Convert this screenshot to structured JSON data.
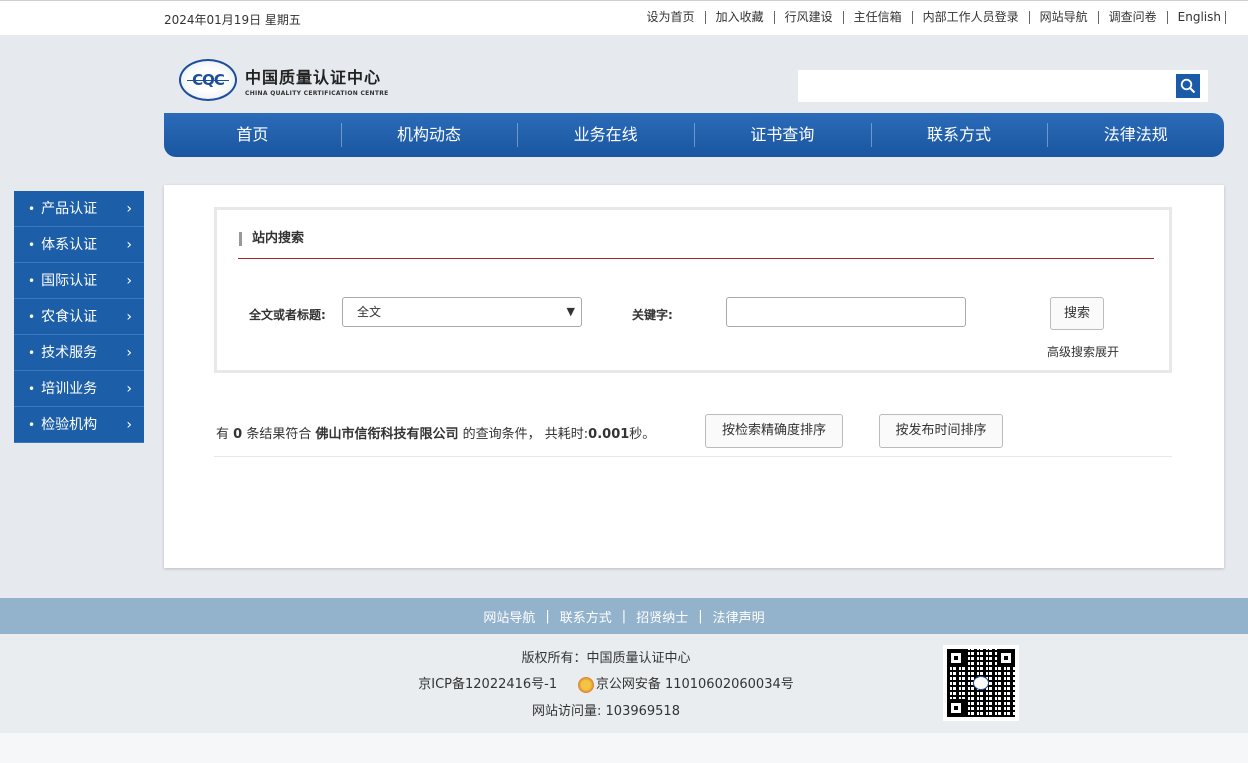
{
  "topbar": {
    "date": "2024年01月19日  星期五",
    "links": [
      "设为首页",
      "加入收藏",
      "行风建设",
      "主任信箱",
      "内部工作人员登录",
      "网站导航",
      "调查问卷",
      "English"
    ]
  },
  "logo": {
    "mark": "CQC",
    "cn": "中国质量认证中心",
    "en": "CHINA QUALITY CERTIFICATION CENTRE"
  },
  "search": {
    "value": "",
    "icon": "search-icon"
  },
  "nav": [
    "首页",
    "机构动态",
    "业务在线",
    "证书查询",
    "联系方式",
    "法律法规"
  ],
  "sidebar": [
    "产品认证",
    "体系认证",
    "国际认证",
    "农食认证",
    "技术服务",
    "培训业务",
    "检验机构"
  ],
  "searchbox": {
    "title": "站内搜索",
    "scope_label": "全文或者标题:",
    "scope_value": "全文",
    "keyword_label": "关键字:",
    "keyword_value": "",
    "search_button": "搜索",
    "advanced": "高级搜索展开"
  },
  "result": {
    "prefix": "有",
    "count": "0",
    "mid": "条结果符合",
    "query": "佛山市信衔科技有限公司",
    "suffix": "的查询条件， 共耗时:",
    "time": "0.001",
    "unit": "秒。",
    "sort_relevance": "按检索精确度排序",
    "sort_time": "按发布时间排序"
  },
  "footer": {
    "links": [
      "网站导航",
      "联系方式",
      "招贤纳士",
      "法律声明"
    ],
    "copyright": "版权所有：中国质量认证中心",
    "icp": "京ICP备12022416号-1",
    "police": "京公网安备 11010602060034号",
    "visits": "网站访问量: 103969518"
  },
  "colors": {
    "primary": "#1c5ea8",
    "footer_nav": "#93b2cc",
    "accent_line": "#9e2a2a"
  }
}
